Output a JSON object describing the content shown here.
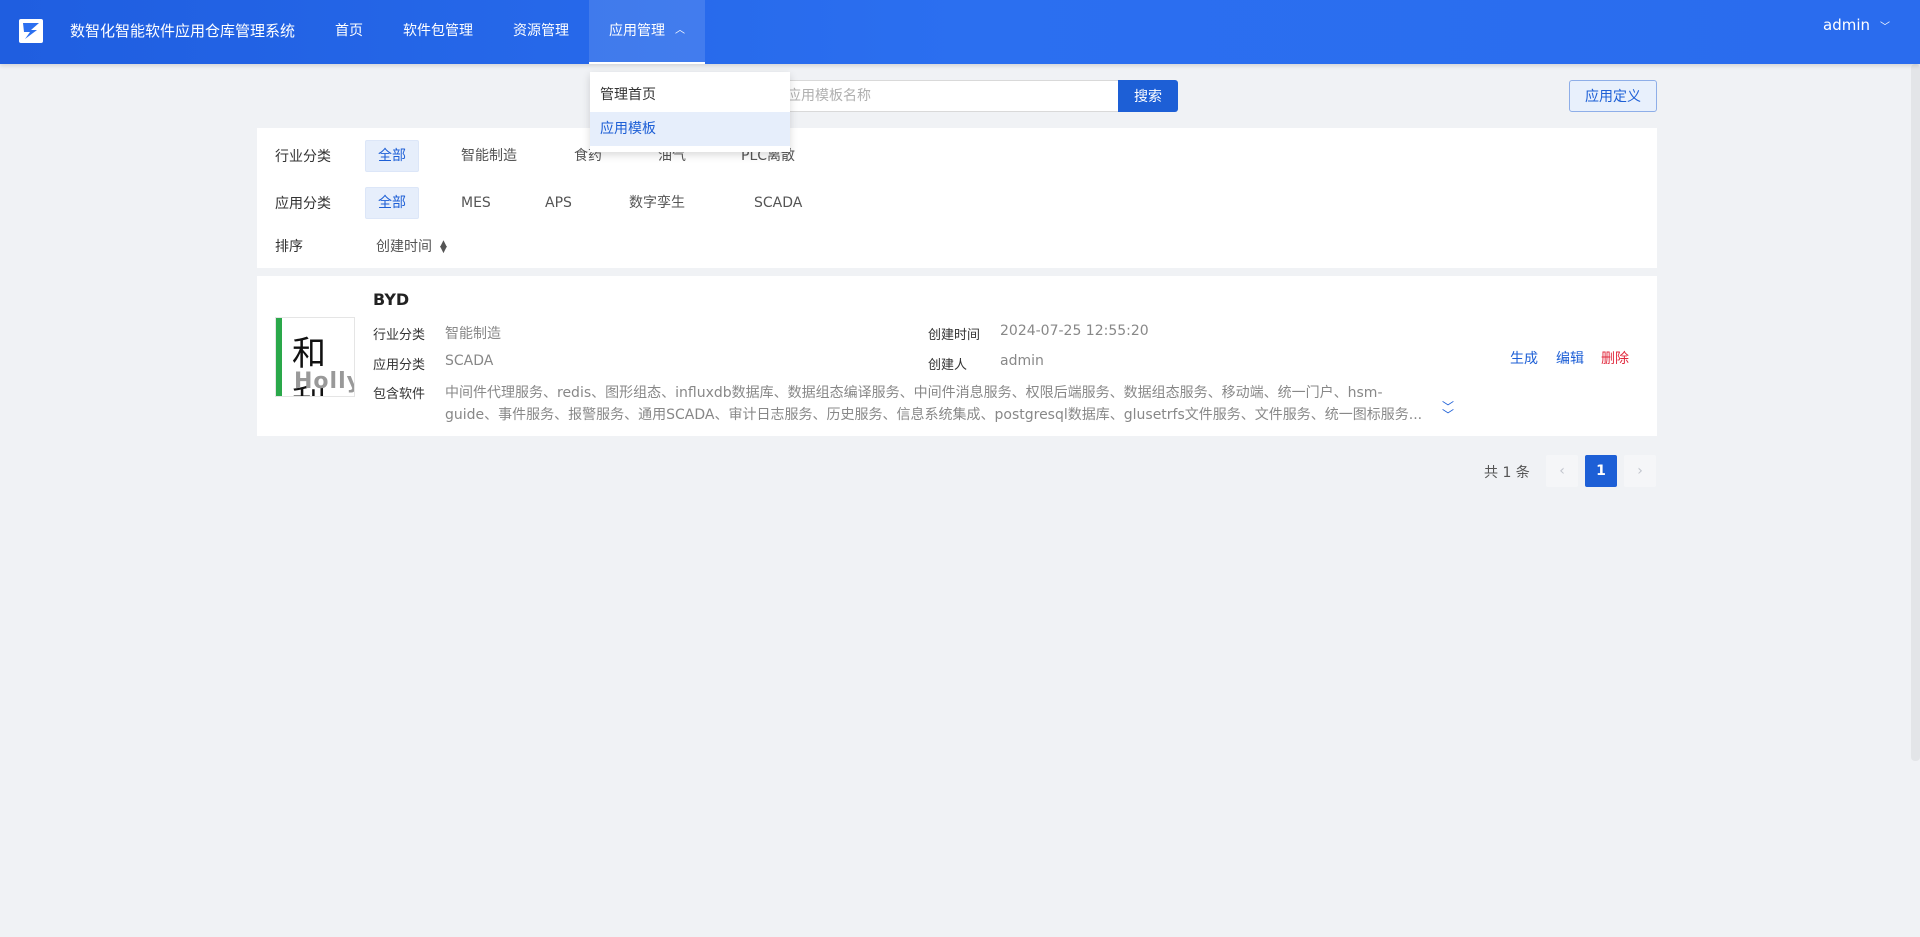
{
  "header": {
    "title": "数智化智能软件应用仓库管理系统",
    "nav": [
      "首页",
      "软件包管理",
      "资源管理",
      "应用管理"
    ],
    "user": "admin"
  },
  "dropdown": {
    "items": [
      "管理首页",
      "应用模板"
    ],
    "active": "应用模板"
  },
  "search": {
    "placeholder": "应用模板名称",
    "button": "搜索"
  },
  "define_button": "应用定义",
  "filters": {
    "industry": {
      "label": "行业分类",
      "options": [
        "全部",
        "智能制造",
        "食药",
        "油气",
        "PLC离散"
      ]
    },
    "app": {
      "label": "应用分类",
      "options": [
        "全部",
        "MES",
        "APS",
        "数字孪生",
        "SCADA"
      ]
    },
    "sort": {
      "label": "排序",
      "option": "创建时间"
    }
  },
  "card": {
    "title": "BYD",
    "thumb_brand": "Holly",
    "thumb_chars": "和利",
    "industry_label": "行业分类",
    "industry_value": "智能制造",
    "app_label": "应用分类",
    "app_value": "SCADA",
    "software_label": "包含软件",
    "software_value": "中间件代理服务、redis、图形组态、influxdb数据库、数据组态编译服务、中间件消息服务、权限后端服务、数据组态服务、移动端、统一门户、hsm-guide、事件服务、报警服务、通用SCADA、审计日志服务、历史服务、信息系统集成、postgresql数据库、glusetrfs文件服务、文件服务、统一图标服务...",
    "created_label": "创建时间",
    "created_value": "2024-07-25 12:55:20",
    "creator_label": "创建人",
    "creator_value": "admin",
    "actions": {
      "generate": "生成",
      "edit": "编辑",
      "delete": "删除"
    }
  },
  "pagination": {
    "total": "共 1 条",
    "current": "1",
    "prev_icon": "chevron-left-icon",
    "next_icon": "chevron-right-icon"
  },
  "colors": {
    "primary": "#1d5fd6",
    "header": "#2b6ff0",
    "danger": "#e0283c",
    "background": "#f0f2f5"
  }
}
